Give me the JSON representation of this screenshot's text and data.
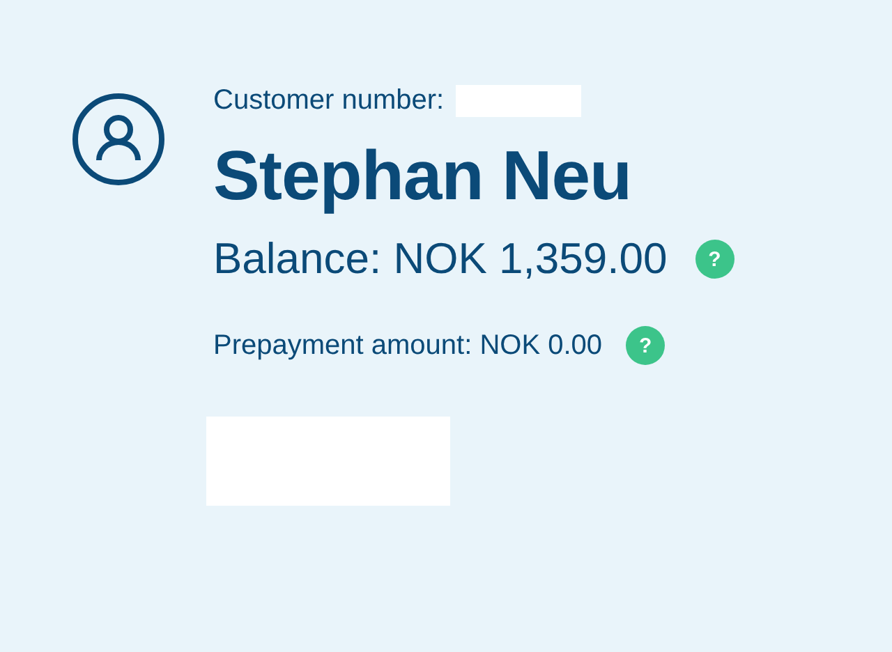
{
  "customer_number_label": "Customer number:",
  "name": "Stephan Neu",
  "balance": {
    "text": "Balance: NOK 1,359.00",
    "help": "?"
  },
  "prepayment": {
    "text": "Prepayment amount: NOK 0.00",
    "help": "?"
  }
}
